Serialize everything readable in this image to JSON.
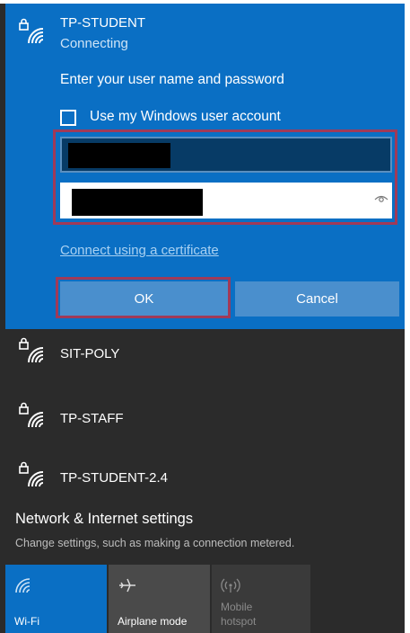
{
  "colors": {
    "accent": "#0a6fc4",
    "background": "#2b2b2b",
    "highlight": "#a03a58",
    "button": "#4a8fcd"
  },
  "active_network": {
    "icon": "wifi-secured-icon",
    "ssid": "TP-STUDENT",
    "status": "Connecting",
    "prompt": "Enter your user name and password",
    "checkbox_label": "Use my Windows user account",
    "checkbox_checked": false,
    "cert_link": "Connect using a certificate",
    "ok_label": "OK",
    "cancel_label": "Cancel"
  },
  "networks": [
    {
      "ssid": "SIT-POLY",
      "icon": "wifi-secured-icon"
    },
    {
      "ssid": "TP-STAFF",
      "icon": "wifi-secured-icon"
    },
    {
      "ssid": "TP-STUDENT-2.4",
      "icon": "wifi-secured-icon"
    }
  ],
  "settings": {
    "title": "Network & Internet settings",
    "description": "Change settings, such as making a connection metered."
  },
  "quick_actions": [
    {
      "label": "Wi-Fi",
      "icon": "wifi-icon",
      "active": true
    },
    {
      "label": "Airplane mode",
      "icon": "airplane-icon",
      "active": false
    },
    {
      "label_line1": "Mobile",
      "label_line2": "hotspot",
      "icon": "hotspot-icon",
      "active": false
    }
  ]
}
